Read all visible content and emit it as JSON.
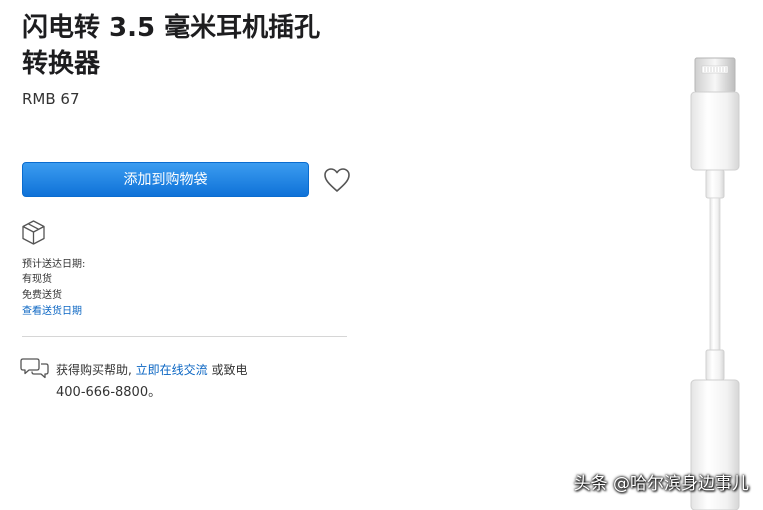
{
  "product": {
    "title_line1": "闪电转 3.5 毫米耳机插孔",
    "title_line2": "转换器",
    "price": "RMB 67",
    "add_to_bag_label": "添加到购物袋"
  },
  "shipping": {
    "label": "预计送达日期:",
    "stock": "有现货",
    "delivery": "免费送货",
    "link": "查看送货日期"
  },
  "help": {
    "prefix": "获得购买帮助, ",
    "chat_link": "立即在线交流",
    "suffix": " 或致电",
    "phone": "400-666-8800。"
  },
  "watermark": "头条 @哈尔滨身边事儿",
  "icons": {
    "wishlist": "heart-icon",
    "shipping": "box-icon",
    "help": "chat-bubbles-icon"
  },
  "colors": {
    "accent": "#0071e3",
    "link": "#0b66c3"
  }
}
